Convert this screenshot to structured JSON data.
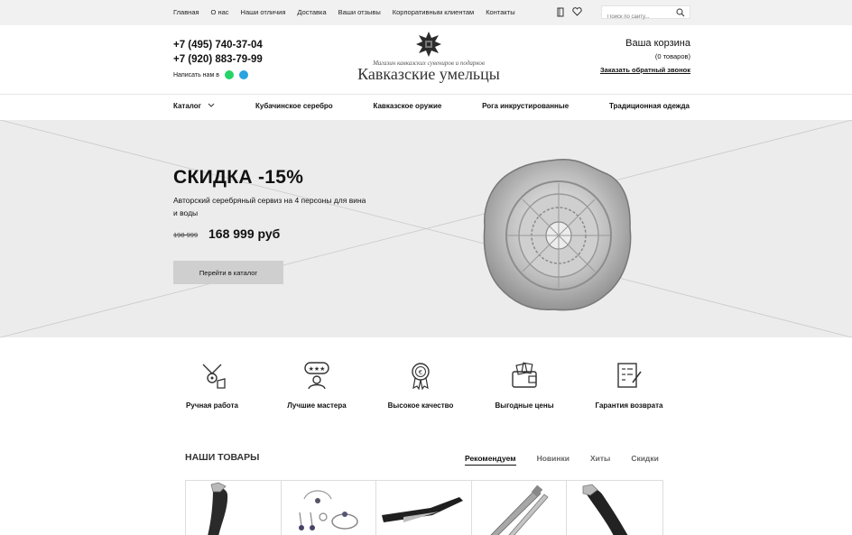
{
  "topbar": {
    "nav": [
      "Главная",
      "О нас",
      "Наши отличия",
      "Доставка",
      "Ваши отзывы",
      "Корпоративным клиентам",
      "Контакты"
    ],
    "search_placeholder": "Поиск по сайту..."
  },
  "header": {
    "phone1": "+7 (495) 740-37-04",
    "phone2": "+7 (920) 883-79-99",
    "write_us": "Написать нам в",
    "logo_tagline": "Магазин кавказских сувениров и подарков",
    "logo_name": "Кавказские умельцы",
    "cart_title": "Ваша корзина",
    "cart_count": "(0 товаров)",
    "callback": "Заказать обратный звонок"
  },
  "mainnav": [
    "Каталог",
    "Кубачинское серебро",
    "Кавказское оружие",
    "Рога инкрустированные",
    "Традиционная одежда"
  ],
  "hero": {
    "title": "СКИДКА -15%",
    "description": "Авторский серебряный сервиз на 4 персоны для вина и воды",
    "old_price": "198 999",
    "price": "168 999 руб",
    "button": "Перейти в каталог"
  },
  "features": [
    {
      "label": "Ручная работа",
      "icon": "handmade-icon"
    },
    {
      "label": "Лучшие мастера",
      "icon": "masters-icon"
    },
    {
      "label": "Высокое качество",
      "icon": "quality-icon"
    },
    {
      "label": "Выгодные цены",
      "icon": "wallet-icon"
    },
    {
      "label": "Гарантия возврата",
      "icon": "guarantee-icon"
    }
  ],
  "goods": {
    "title": "НАШИ ТОВАРЫ",
    "tabs": [
      "Рекомендуем",
      "Новинки",
      "Хиты",
      "Скидки"
    ]
  },
  "colors": {
    "topbar": "#f1f1f1",
    "hero": "#ececec",
    "whatsapp": "#25d366",
    "telegram": "#2aa3df"
  }
}
